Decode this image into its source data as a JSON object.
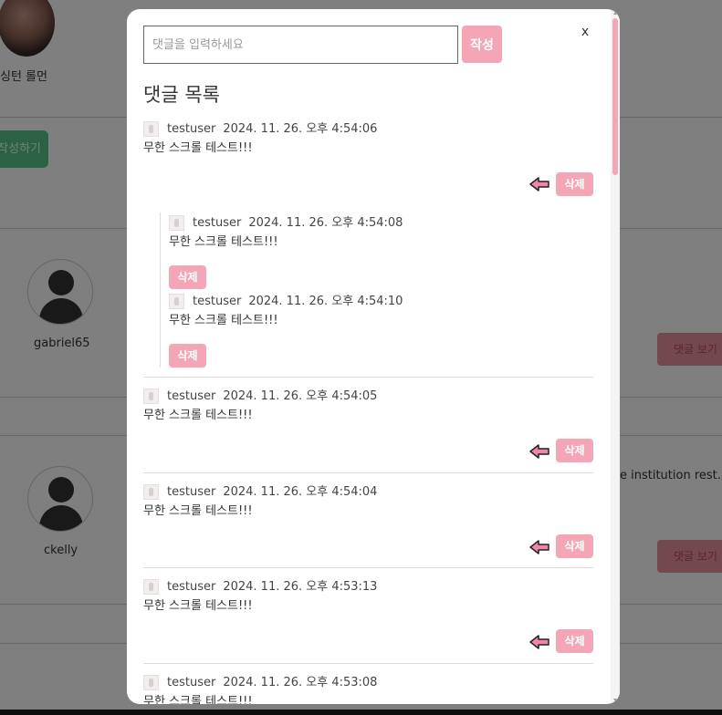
{
  "background": {
    "top_user_name": "싱턴 롤먼",
    "green_button_label": "작성하기",
    "users": [
      {
        "name": "gabriel65",
        "button_label": "댓글 보기"
      },
      {
        "name": "ckelly",
        "button_label": "댓글 보기",
        "post_excerpt": "e institution rest."
      }
    ]
  },
  "modal": {
    "input_placeholder": "댓글을 입력하세요",
    "submit_label": "작성",
    "close_label": "x",
    "list_title": "댓글 목록",
    "comments": [
      {
        "user": "testuser",
        "time": "2024. 11. 26. 오후 4:54:06",
        "text": "무한 스크롤 테스트!!!",
        "delete_label": "삭제",
        "replies": [
          {
            "user": "testuser",
            "time": "2024. 11. 26. 오후 4:54:08",
            "text": "무한 스크롤 테스트!!!",
            "delete_label": "삭제"
          },
          {
            "user": "testuser",
            "time": "2024. 11. 26. 오후 4:54:10",
            "text": "무한 스크롤 테스트!!!",
            "delete_label": "삭제"
          }
        ]
      },
      {
        "user": "testuser",
        "time": "2024. 11. 26. 오후 4:54:05",
        "text": "무한 스크롤 테스트!!!",
        "delete_label": "삭제"
      },
      {
        "user": "testuser",
        "time": "2024. 11. 26. 오후 4:54:04",
        "text": "무한 스크롤 테스트!!!",
        "delete_label": "삭제"
      },
      {
        "user": "testuser",
        "time": "2024. 11. 26. 오후 4:53:13",
        "text": "무한 스크롤 테스트!!!",
        "delete_label": "삭제"
      },
      {
        "user": "testuser",
        "time": "2024. 11. 26. 오후 4:53:08",
        "text": "무한 스크롤 테스트!!!"
      }
    ]
  },
  "colors": {
    "accent_pink": "#f4a6b6",
    "green": "#57c48c",
    "overlay": "rgba(0,0,0,0.5)"
  },
  "icons": {
    "reply": "reply-arrow-icon",
    "avatar": "user-avatar-icon",
    "close": "close-icon"
  }
}
